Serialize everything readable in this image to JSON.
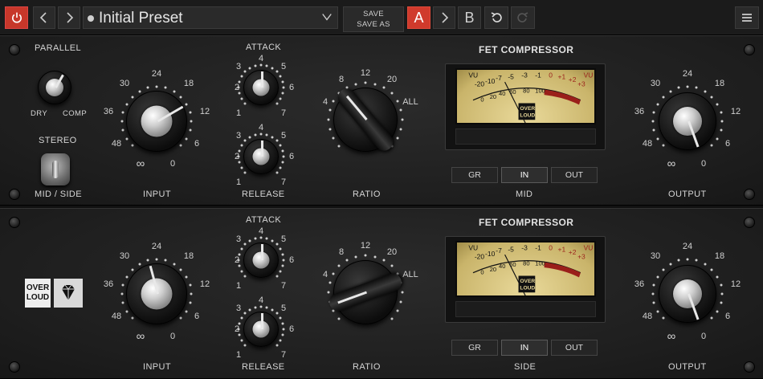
{
  "topbar": {
    "preset_name": "Initial Preset",
    "save": "SAVE",
    "save_as": "SAVE AS",
    "ab_a": "A",
    "ab_b": "B",
    "colors": {
      "accent": "#c7372a",
      "bar": "#1b1b1b"
    }
  },
  "scales": {
    "input": [
      "30",
      "24",
      "18",
      "12",
      "6",
      "0",
      "∞",
      "48",
      "36"
    ],
    "attack_release": [
      "1",
      "2",
      "3",
      "4",
      "5",
      "6",
      "7"
    ],
    "ratio": [
      "4",
      "8",
      "12",
      "20",
      "ALL"
    ],
    "output": [
      "30",
      "24",
      "18",
      "12",
      "6",
      "0",
      "∞",
      "48",
      "36"
    ],
    "vu": [
      "VU",
      "-20",
      "-10",
      "-7",
      "-5",
      "-3",
      "-1",
      "0",
      "+1",
      "+2",
      "+3",
      "VU",
      "0",
      "20",
      "40",
      "60",
      "80",
      "100"
    ],
    "vu_brand": [
      "OVER",
      "LOUD"
    ]
  },
  "panels": [
    {
      "id": "mid",
      "parallel_label": "PARALLEL",
      "parallel_dry": "DRY",
      "parallel_comp": "COMP",
      "stereo_label": "STEREO",
      "stereo_mode": "MID / SIDE",
      "input_label": "INPUT",
      "attack_label": "ATTACK",
      "release_label": "RELEASE",
      "ratio_label": "RATIO",
      "meter_title": "FET COMPRESSOR",
      "meter_buttons": [
        "GR",
        "IN",
        "OUT"
      ],
      "channel_label": "MID",
      "output_label": "OUTPUT"
    },
    {
      "id": "side",
      "logo_text": [
        "OVER",
        "LOUD"
      ],
      "input_label": "INPUT",
      "attack_label": "ATTACK",
      "release_label": "RELEASE",
      "ratio_label": "RATIO",
      "meter_title": "FET COMPRESSOR",
      "meter_buttons": [
        "GR",
        "IN",
        "OUT"
      ],
      "channel_label": "SIDE",
      "output_label": "OUTPUT"
    }
  ]
}
